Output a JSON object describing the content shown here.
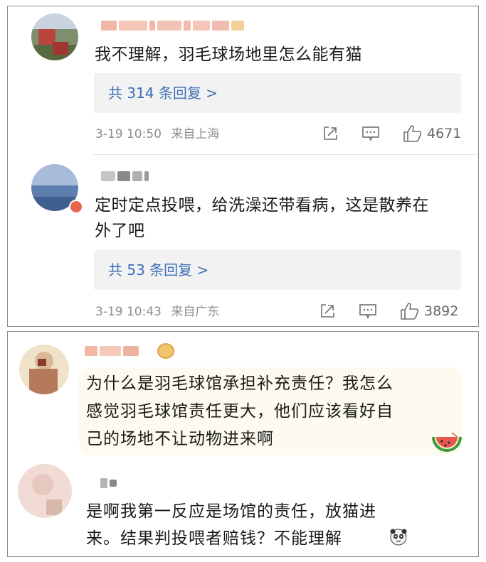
{
  "top_panel": {
    "comments": [
      {
        "text": "我不理解，羽毛球场地里怎么能有猫",
        "replies_label": "共 314 条回复 >",
        "time": "3-19 10:50",
        "location": "来自上海",
        "likes": "4671"
      },
      {
        "text_line1": "定时定点投喂，给洗澡还带看病，这是散养在",
        "text_line2": "外了吧",
        "replies_label": "共 53 条回复 >",
        "time": "3-19 10:43",
        "location": "来自广东",
        "likes": "3892"
      }
    ]
  },
  "bottom_panel": {
    "comments": [
      {
        "text_line1": "为什么是羽毛球馆承担补充责任？我怎么",
        "text_line2": "感觉羽毛球馆责任更大，他们应该看好自",
        "text_line3": "己的场地不让动物进来啊",
        "emoji": "watermelon"
      },
      {
        "text_line1": "是啊我第一反应是场馆的责任，放猫进",
        "text_line2": "来。结果判投喂者赔钱？不能理解",
        "emoji": "panda"
      }
    ]
  },
  "colors": {
    "reply_link": "#3d6fb6",
    "meta_gray": "#8e8e8e",
    "reply_box_bg": "#f2f2f2",
    "bubble_bg": "#fdfbef"
  }
}
